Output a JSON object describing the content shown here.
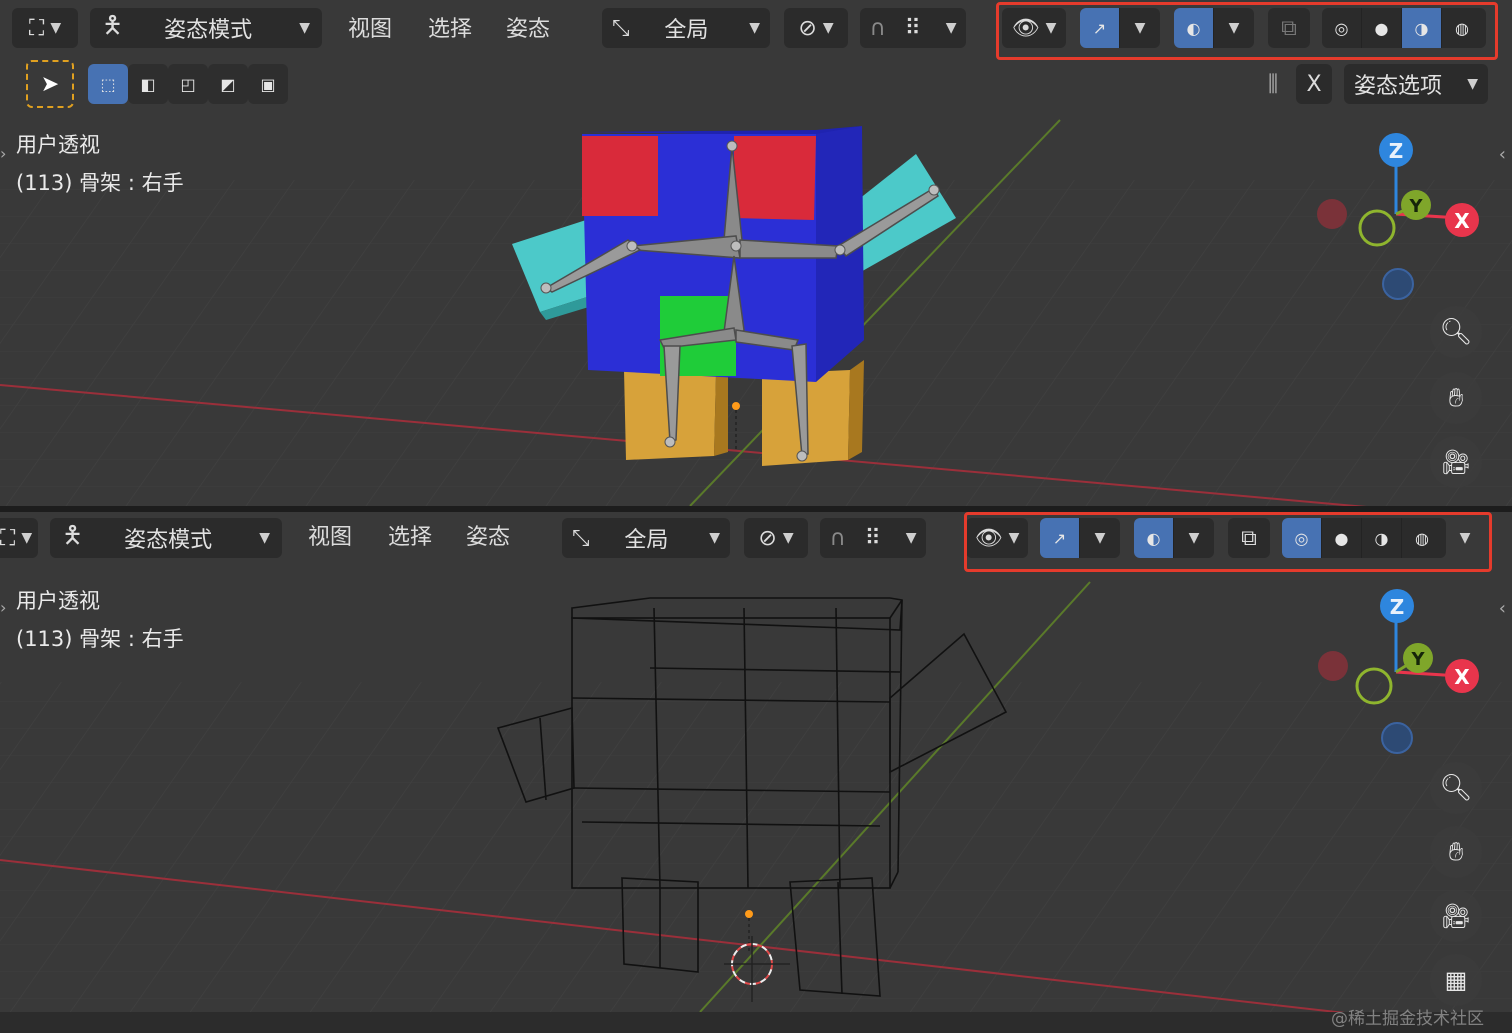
{
  "colors": {
    "accent": "#4772b3",
    "highlight_box": "#e53b2c",
    "axis_x": "#e8354c",
    "axis_y": "#7fa62a",
    "axis_z": "#2e86de",
    "mesh_blue": "#2b2fd6",
    "mesh_red": "#d92a3a",
    "mesh_cyan": "#4cc9c9",
    "mesh_green": "#1fcc39",
    "mesh_orange": "#d7a23a"
  },
  "viewport_top": {
    "header": {
      "mode_label": "姿态模式",
      "menus": [
        "视图",
        "选择",
        "姿态"
      ],
      "orientation_label": "全局",
      "mirror_x_label": "X",
      "pose_options_label": "姿态选项"
    },
    "overlay": {
      "view_name": "用户透视",
      "object_info": "(113) 骨架 : 右手"
    },
    "shading_mode": "solid",
    "gizmo": {
      "x": "X",
      "y": "Y",
      "z": "Z"
    }
  },
  "viewport_bottom": {
    "header": {
      "mode_label": "姿态模式",
      "menus": [
        "视图",
        "选择",
        "姿态"
      ],
      "orientation_label": "全局"
    },
    "overlay": {
      "view_name": "用户透视",
      "object_info": "(113) 骨架 : 右手"
    },
    "shading_mode": "wireframe",
    "gizmo": {
      "x": "X",
      "y": "Y",
      "z": "Z"
    }
  },
  "watermark": "@稀土掘金技术社区",
  "icons": {
    "viewport_header": [
      "editor-type-icon",
      "pose-mode-icon",
      "orientation-icon",
      "pivot-icon",
      "proportional-icon",
      "snap-icon",
      "visibility-icon",
      "gizmo-icon",
      "overlay-icon",
      "xray-icon",
      "wireframe-shading-icon",
      "solid-shading-icon",
      "material-shading-icon",
      "rendered-shading-icon"
    ],
    "toolbar": [
      "select-tool-icon",
      "box-select-icon",
      "extend-icon",
      "subtract-icon",
      "invert-icon",
      "intersect-icon"
    ],
    "nav": [
      "zoom-icon",
      "pan-hand-icon",
      "camera-icon",
      "grid-icon"
    ]
  }
}
